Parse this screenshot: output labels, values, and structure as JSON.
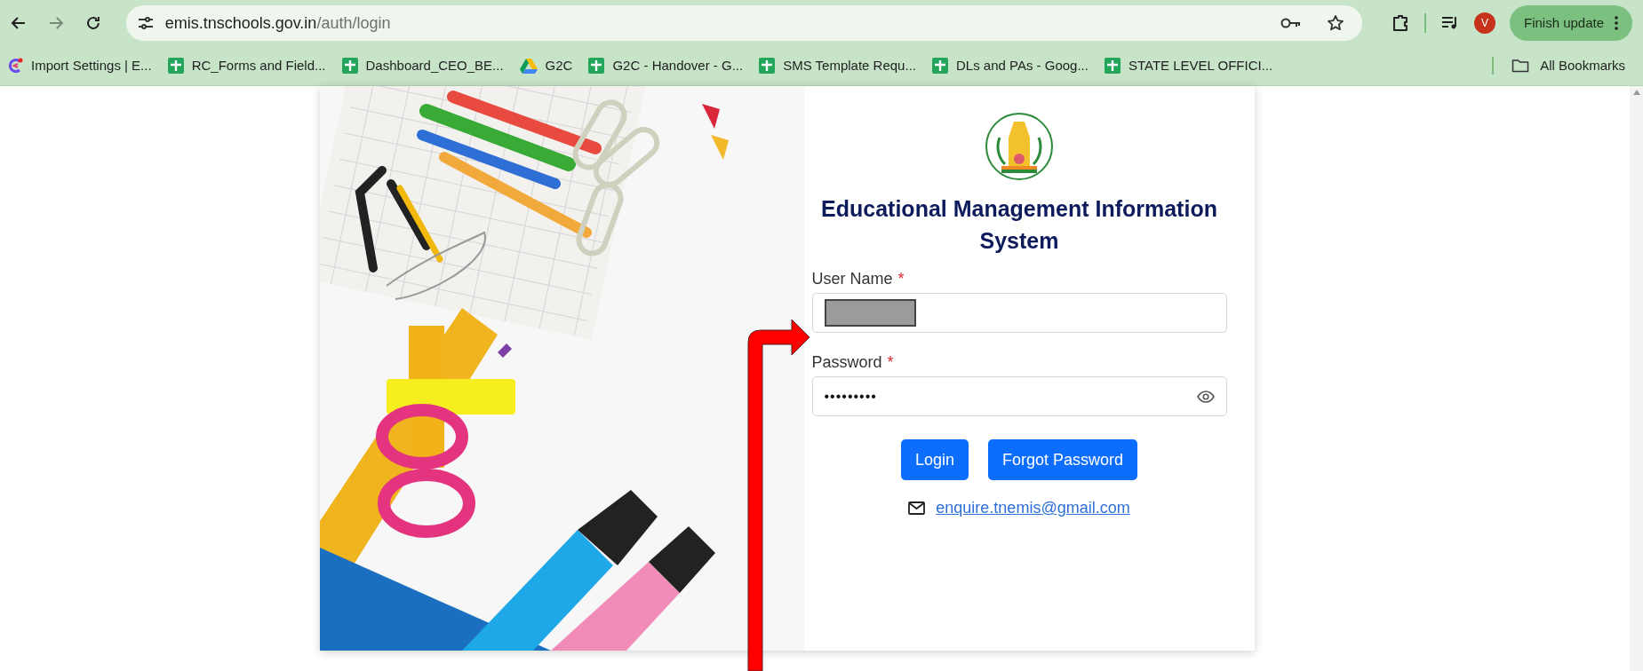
{
  "browser": {
    "address": {
      "host": "emis.tnschools.gov.in",
      "path": "/auth/login"
    },
    "profile_initial": "V",
    "update_button": "Finish update",
    "bookmarks": [
      {
        "kind": "app",
        "label": "Import Settings | E..."
      },
      {
        "kind": "sheet",
        "label": "RC_Forms and Field..."
      },
      {
        "kind": "sheet",
        "label": "Dashboard_CEO_BE..."
      },
      {
        "kind": "drive",
        "label": "G2C"
      },
      {
        "kind": "sheet",
        "label": "G2C - Handover - G..."
      },
      {
        "kind": "sheet",
        "label": "SMS Template Requ..."
      },
      {
        "kind": "sheet",
        "label": "DLs and PAs - Goog..."
      },
      {
        "kind": "sheet",
        "label": "STATE LEVEL OFFICI..."
      }
    ],
    "all_bookmarks": "All Bookmarks"
  },
  "login": {
    "title": "Educational Management Information System",
    "fields": [
      {
        "kind": "text",
        "label": "User Name",
        "required": true,
        "redacted": true
      },
      {
        "kind": "password",
        "label": "Password",
        "required": true,
        "value": "•••••••••"
      }
    ],
    "required_mark": "*",
    "buttons": [
      "Login",
      "Forgot Password"
    ],
    "email": "enquire.tnemis@gmail.com"
  }
}
